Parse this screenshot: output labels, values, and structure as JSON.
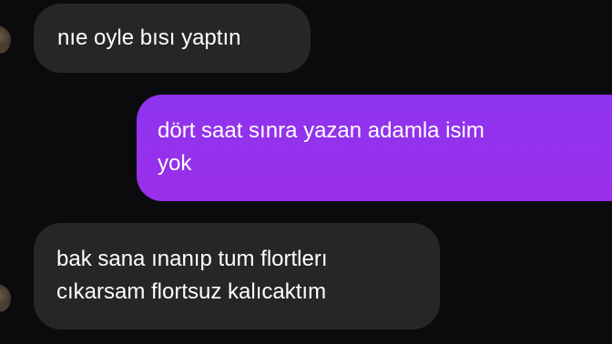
{
  "messages": [
    {
      "direction": "incoming",
      "lines": [
        "nıe oyle bısı yaptın"
      ]
    },
    {
      "direction": "outgoing",
      "lines": [
        "dört saat sınra yazan adamla isim",
        "yok"
      ]
    },
    {
      "direction": "incoming",
      "lines": [
        "bak sana ınanıp tum flortlerı",
        "cıkarsam flortsuz kalıcaktım"
      ]
    }
  ],
  "colors": {
    "background": "#0b0b0e",
    "incoming_bubble": "#262629",
    "outgoing_bubble": "#9132ef",
    "text": "#ffffff"
  },
  "icons": {
    "avatar": "contact-avatar"
  }
}
